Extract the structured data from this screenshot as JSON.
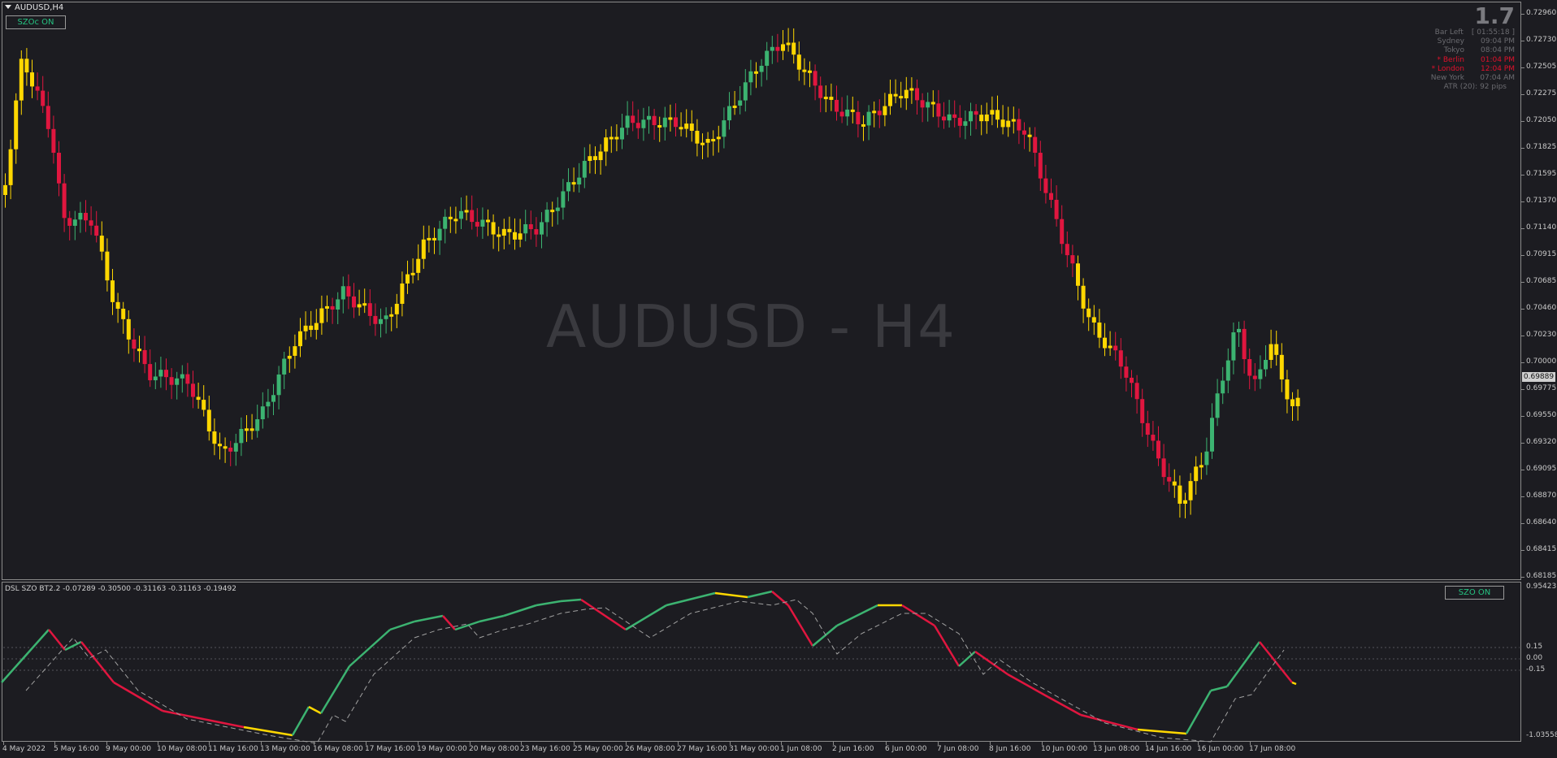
{
  "chart": {
    "title": "AUDUSD,H4",
    "watermark": "AUDUSD - H4",
    "szoc_button": "SZOc ON",
    "current_price": "0.69889"
  },
  "info_panel": {
    "big_value": "1.7",
    "rows": [
      {
        "label": "Bar Left",
        "value": "[ 01:55:18 ]",
        "color": "#6b6b70"
      },
      {
        "label": "Sydney",
        "value": "09:04 PM",
        "color": "#6b6b70"
      },
      {
        "label": "Tokyo",
        "value": "08:04 PM",
        "color": "#6b6b70"
      },
      {
        "label": "* Berlin",
        "value": "01:04 PM",
        "color": "#e0112b"
      },
      {
        "label": "* London",
        "value": "12:04 PM",
        "color": "#e0112b"
      },
      {
        "label": "New York",
        "value": "07:04 AM",
        "color": "#6b6b70"
      },
      {
        "label": "ATR (20): 92 pips",
        "value": "",
        "color": "#6b6b70"
      }
    ]
  },
  "price_axis": [
    "0.72960",
    "0.72730",
    "0.72505",
    "0.72275",
    "0.72050",
    "0.71825",
    "0.71595",
    "0.71370",
    "0.71140",
    "0.70915",
    "0.70685",
    "0.70460",
    "0.70230",
    "0.70000",
    "0.69775",
    "0.69550",
    "0.69320",
    "0.69095",
    "0.68870",
    "0.68640",
    "0.68415",
    "0.68185"
  ],
  "indicator": {
    "label": "DSL SZO BT2.2 -0.07289 -0.30500 -0.31163 -0.31163 -0.19492",
    "button": "SZO ON",
    "axis": [
      "0.95423",
      "0.15",
      "0.00",
      "-0.15",
      "-1.03558"
    ]
  },
  "time_axis": [
    "4 May 2022",
    "5 May 16:00",
    "9 May 00:00",
    "10 May 08:00",
    "11 May 16:00",
    "13 May 00:00",
    "16 May 08:00",
    "17 May 16:00",
    "19 May 00:00",
    "20 May 08:00",
    "23 May 16:00",
    "25 May 00:00",
    "26 May 08:00",
    "27 May 16:00",
    "31 May 00:00",
    "1 Jun 08:00",
    "2 Jun 16:00",
    "6 Jun 00:00",
    "7 Jun 08:00",
    "8 Jun 16:00",
    "10 Jun 00:00",
    "13 Jun 08:00",
    "14 Jun 16:00",
    "16 Jun 00:00",
    "17 Jun 08:00"
  ],
  "colors": {
    "green": "#3cb371",
    "yellow": "#ffd700",
    "red": "#e0163f",
    "background": "#1c1c21"
  },
  "icons": [
    "dropdown-triangle-icon"
  ]
}
